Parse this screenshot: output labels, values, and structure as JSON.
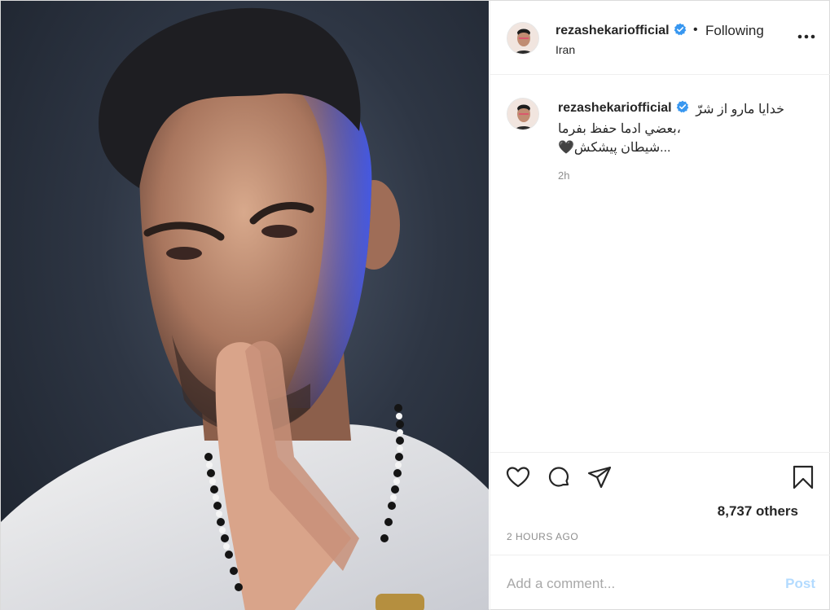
{
  "post": {
    "username": "rezashekariofficial",
    "follow_separator": "•",
    "follow_label": "Following",
    "location": "Iran",
    "caption_line_1": "خدایا مارو از شرّ",
    "caption_line_2": "بعضي ادما حفظ بفرما،",
    "caption_line_3": "شيطان پيشكش...",
    "caption_emoji": "🖤",
    "caption_age": "2h",
    "likes_text": "8,737 others",
    "timestamp": "2 HOURS AGO",
    "comment_placeholder": "Add a comment...",
    "post_button": "Post"
  },
  "colors": {
    "verified_blue": "#3897f0",
    "post_button_disabled": "#b3dbff",
    "muted_text": "#8e8e8e"
  },
  "icons": [
    "verified-badge-icon",
    "more-options-icon",
    "heart-icon",
    "comment-icon",
    "share-icon",
    "bookmark-icon"
  ]
}
